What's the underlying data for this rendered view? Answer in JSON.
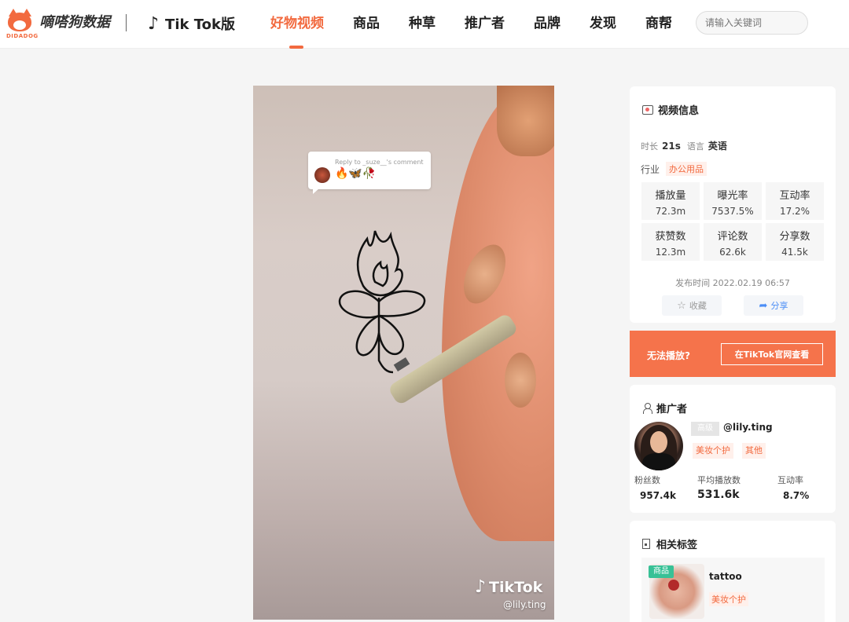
{
  "brand": {
    "name": "嘀嗒狗数据",
    "sub": "DIDADOG",
    "platform": "Tik Tok版"
  },
  "nav": {
    "items": [
      {
        "label": "好物视频",
        "active": true
      },
      {
        "label": "商品",
        "active": false
      },
      {
        "label": "种草",
        "active": false
      },
      {
        "label": "推广者",
        "active": false
      },
      {
        "label": "品牌",
        "active": false
      },
      {
        "label": "发现",
        "active": false
      },
      {
        "label": "商帮",
        "active": false
      }
    ]
  },
  "search": {
    "placeholder": "请输入关键词",
    "value": ""
  },
  "video": {
    "comment_reply": "Reply to _suze__'s comment",
    "comment_emojis": "🔥🦋🥀",
    "watermark": "TikTok",
    "handle": "@lily.ting"
  },
  "video_info": {
    "title": "视频信息",
    "duration_label": "时长",
    "duration": "21s",
    "language_label": "语言",
    "language": "英语",
    "industry_label": "行业",
    "industry": "办公用品",
    "stats": [
      {
        "label": "播放量",
        "value": "72.3m"
      },
      {
        "label": "曝光率",
        "value": "7537.5%"
      },
      {
        "label": "互动率",
        "value": "17.2%"
      },
      {
        "label": "获赞数",
        "value": "12.3m"
      },
      {
        "label": "评论数",
        "value": "62.6k"
      },
      {
        "label": "分享数",
        "value": "41.5k"
      }
    ],
    "publish": "发布时间 2022.02.19 06:57",
    "favorite_label": "收藏",
    "share_label": "分享"
  },
  "cta": {
    "text": "无法播放?",
    "button": "在TikTok官网查看"
  },
  "promoter": {
    "title": "推广者",
    "level": "高级",
    "handle": "@lily.ting",
    "tags": [
      "美妆个护",
      "其他"
    ],
    "stats": [
      {
        "label": "粉丝数",
        "value": "957.4k"
      },
      {
        "label": "平均播放数",
        "value": "531.6k"
      },
      {
        "label": "互动率",
        "value": "8.7%"
      }
    ]
  },
  "related_tags": {
    "title": "相关标签",
    "item": {
      "badge": "商品",
      "name": "tattoo",
      "category": "美妆个护"
    }
  },
  "colors": {
    "accent": "#f26a3f",
    "cta_bg": "#f5734b",
    "share": "#4a8df6",
    "badge_green": "#38c196"
  }
}
